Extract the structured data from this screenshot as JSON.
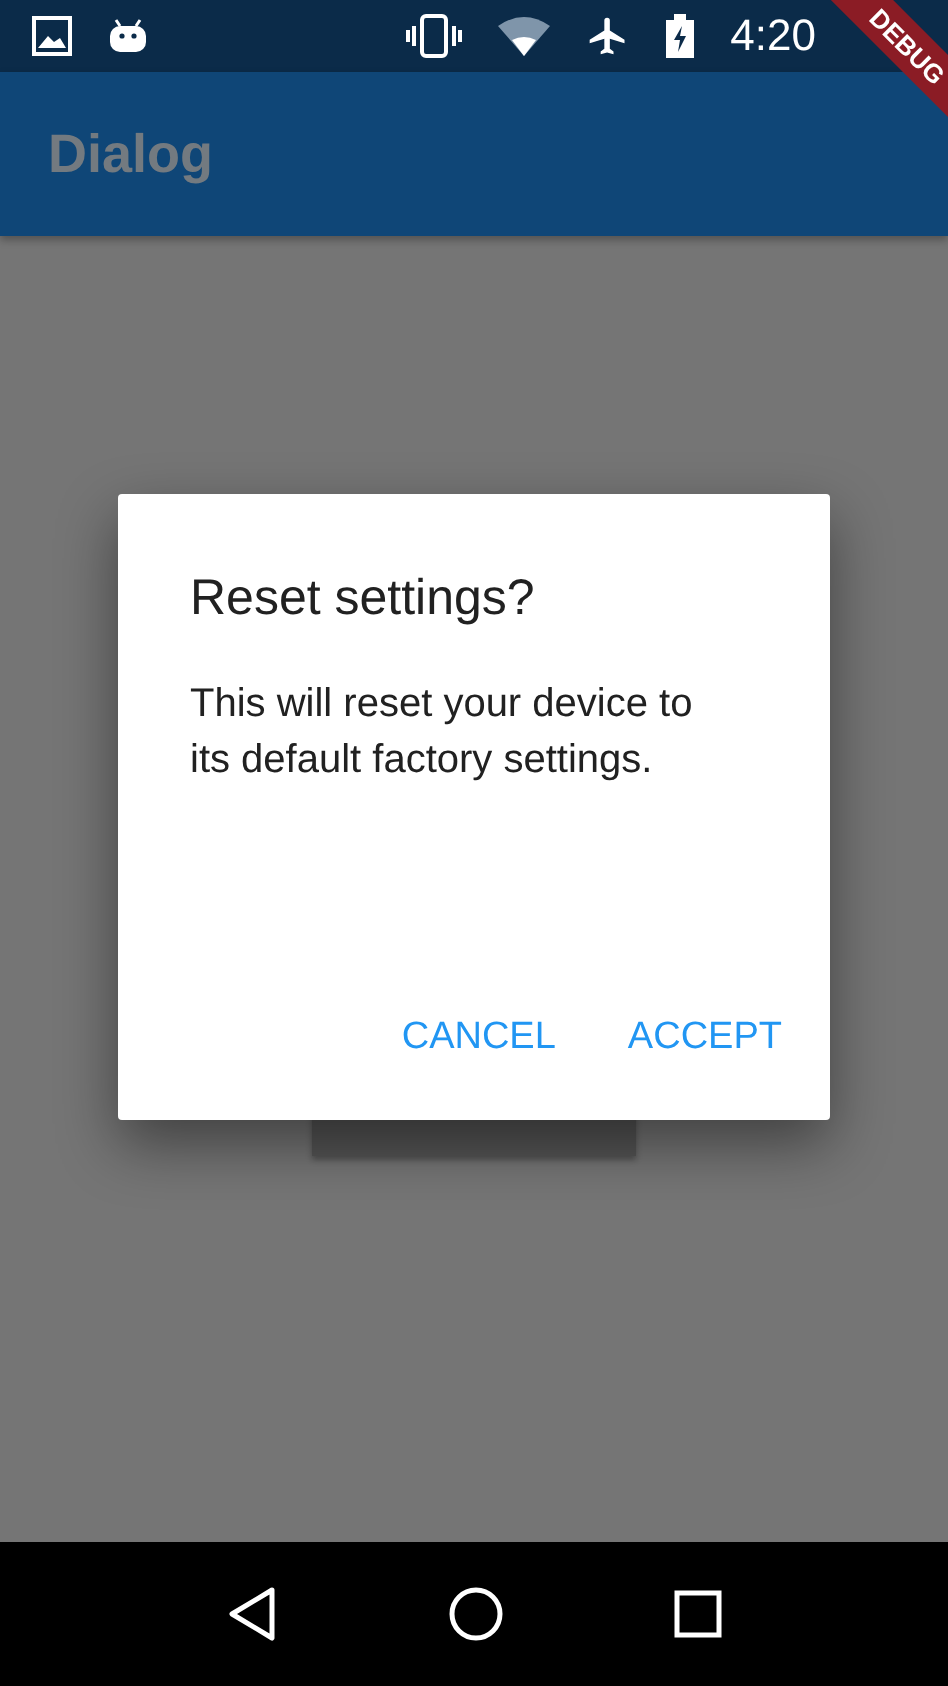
{
  "status_bar": {
    "time": "4:20"
  },
  "debug_banner": {
    "label": "DEBUG"
  },
  "app_bar": {
    "title": "Dialog"
  },
  "dialog": {
    "title": "Reset settings?",
    "message": "This will reset your device to its default factory settings.",
    "actions": [
      {
        "label": "CANCEL"
      },
      {
        "label": "ACCEPT"
      }
    ]
  }
}
